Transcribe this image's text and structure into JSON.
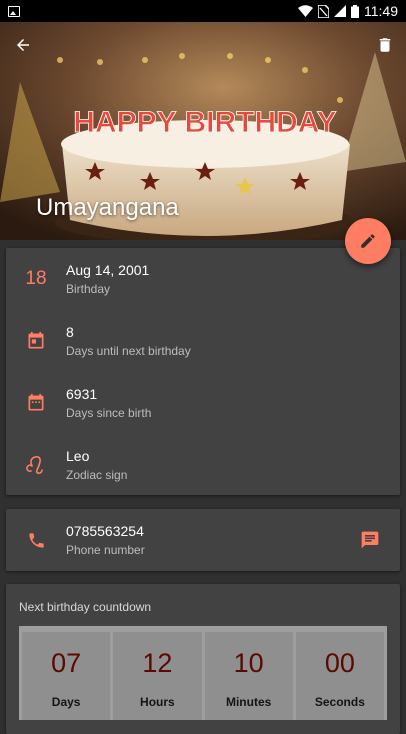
{
  "status_bar": {
    "time": "11:49"
  },
  "header": {
    "name": "Umayangana",
    "cake_text": "HAPPY BIRTHDAY"
  },
  "details": [
    {
      "icon": "number-icon",
      "icon_text": "18",
      "primary": "Aug 14, 2001",
      "secondary": "Birthday"
    },
    {
      "icon": "calendar-icon",
      "primary": "8",
      "secondary": "Days until next birthday"
    },
    {
      "icon": "calendar-icon",
      "primary": "6931",
      "secondary": "Days since birth"
    },
    {
      "icon": "leo-zodiac-icon",
      "primary": "Leo",
      "secondary": "Zodiac sign"
    }
  ],
  "contact": {
    "primary": "0785563254",
    "secondary": "Phone number"
  },
  "countdown": {
    "title": "Next birthday countdown",
    "cells": [
      {
        "value": "07",
        "label": "Days"
      },
      {
        "value": "12",
        "label": "Hours"
      },
      {
        "value": "10",
        "label": "Minutes"
      },
      {
        "value": "00",
        "label": "Seconds"
      }
    ]
  },
  "colors": {
    "accent": "#ff7d63",
    "background": "#303030",
    "card": "#424242",
    "countdown_value": "#5a0a00"
  }
}
